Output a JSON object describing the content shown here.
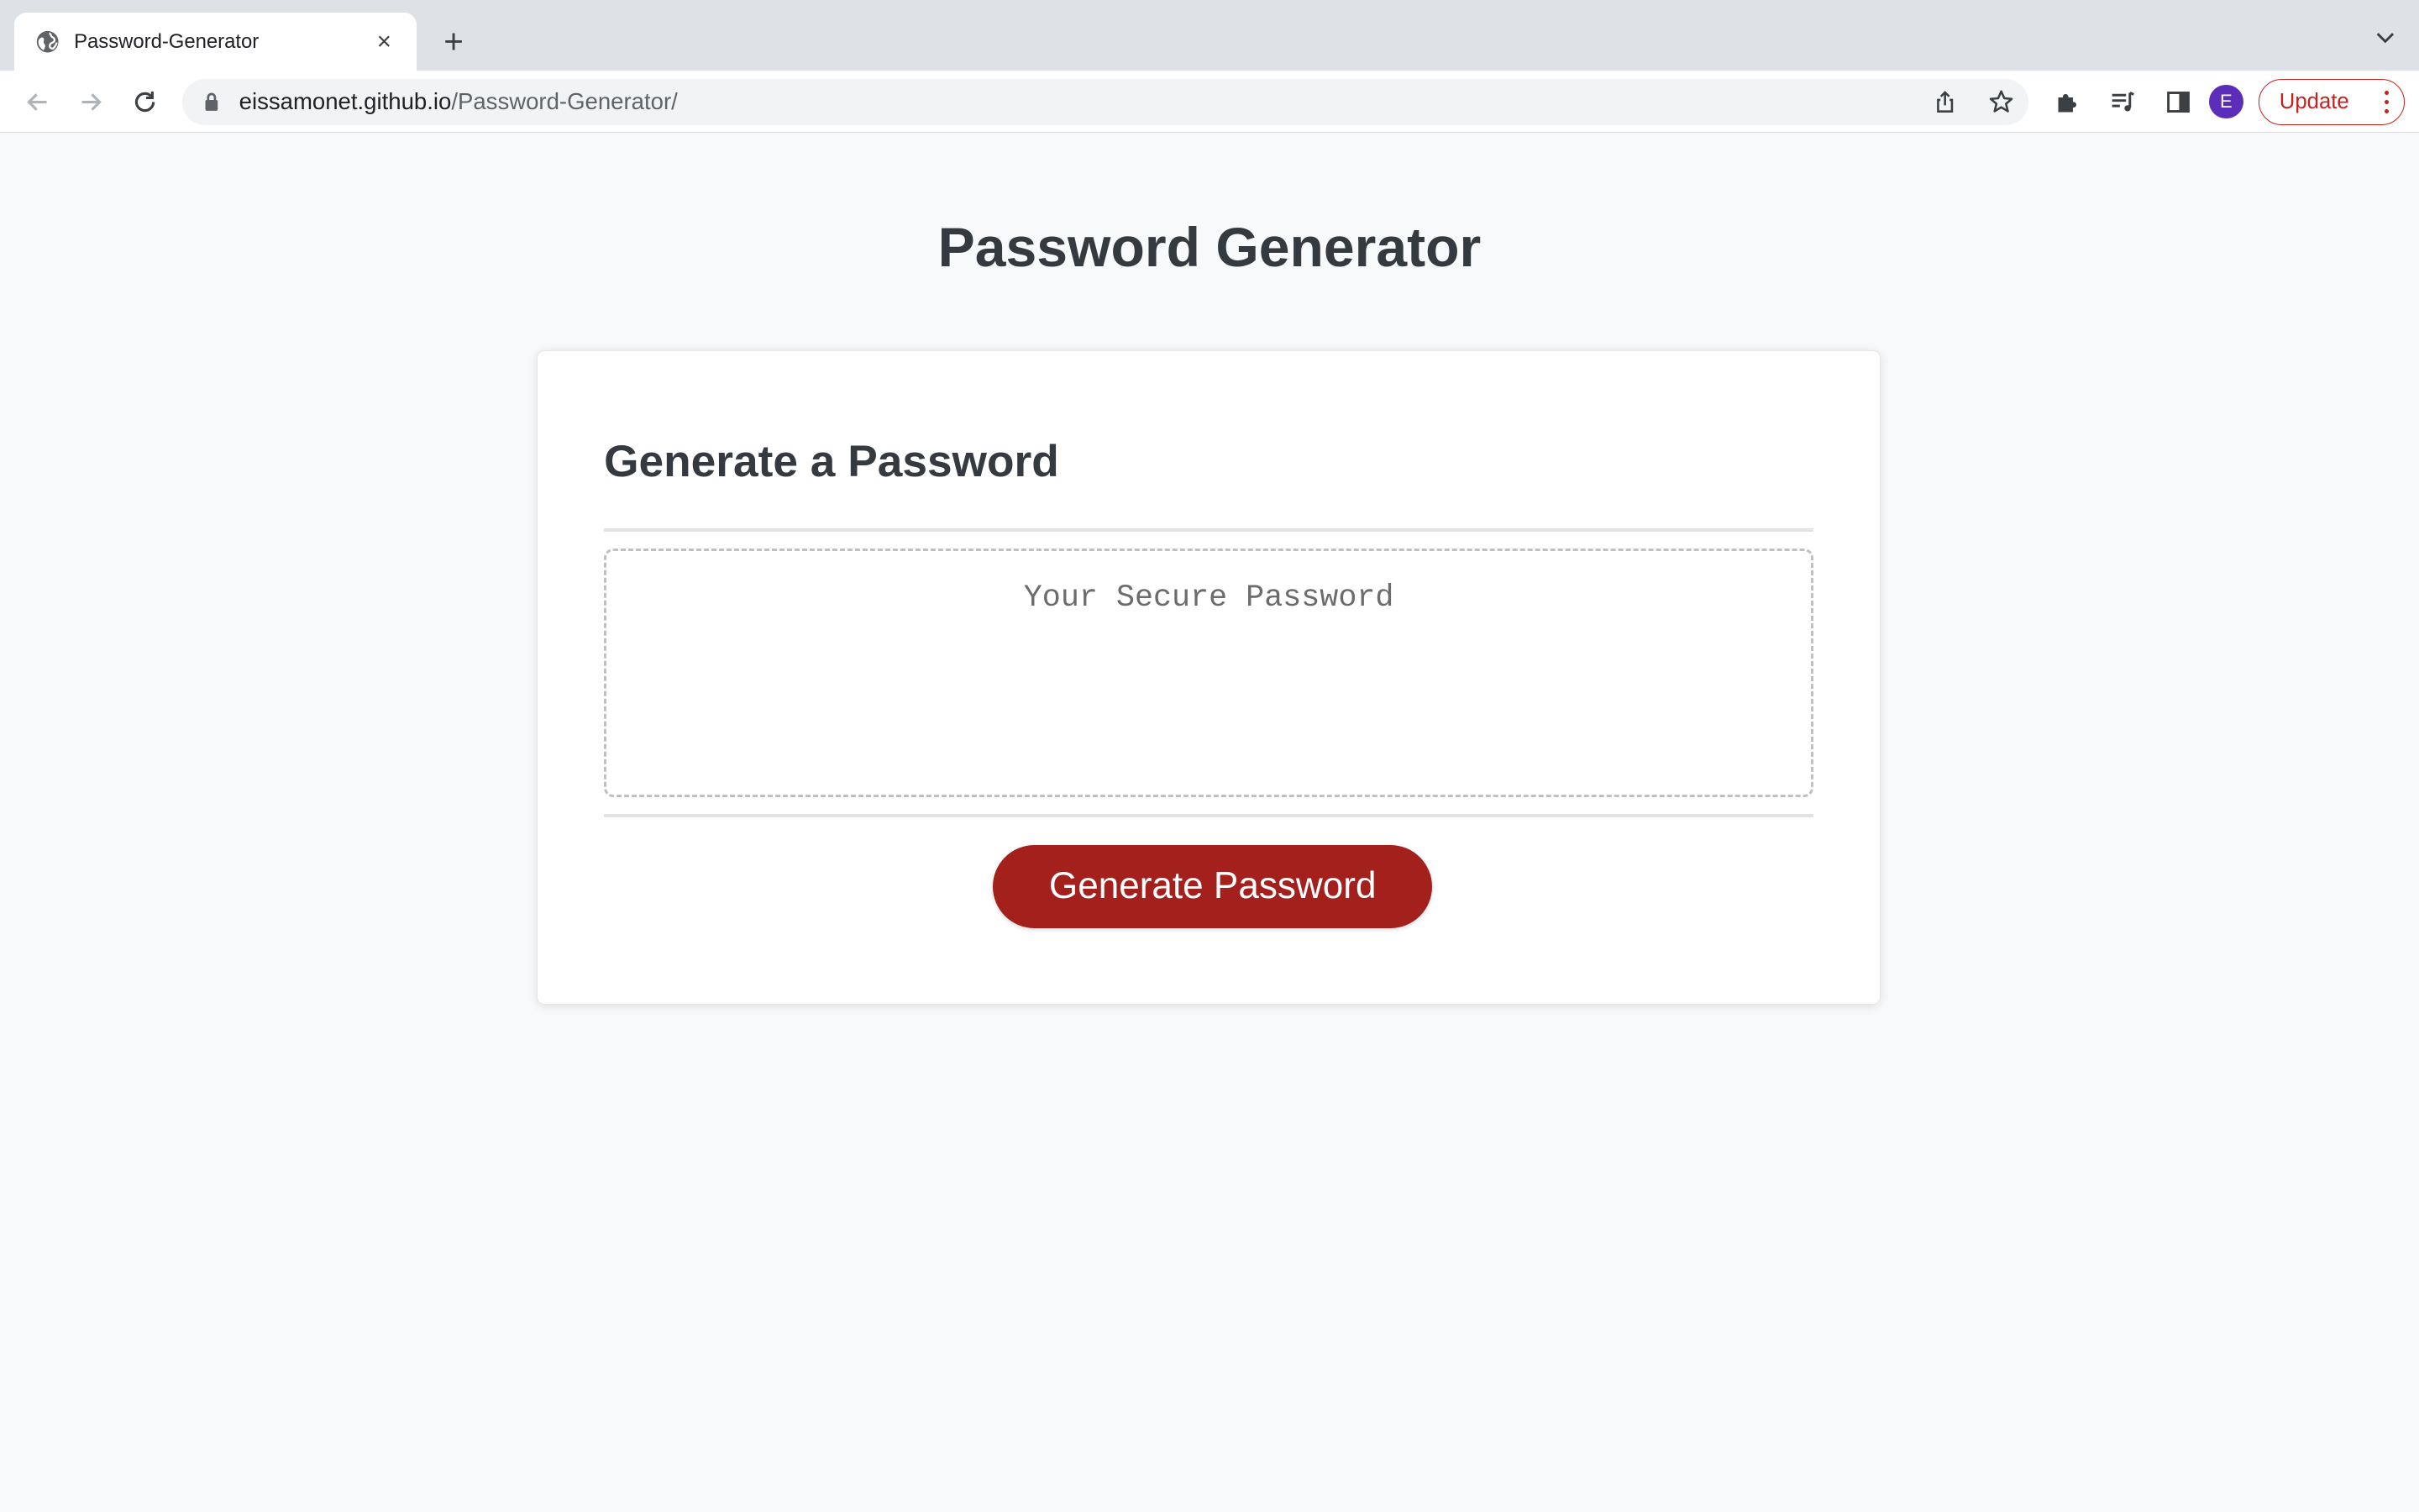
{
  "browser": {
    "tab": {
      "title": "Password-Generator",
      "close_glyph": "×",
      "favicon": "globe-icon"
    },
    "new_tab_glyph": "+",
    "address": {
      "host": "eissamonet.github.io",
      "path": "/Password-Generator/"
    },
    "profile_initial": "E",
    "update_label": "Update"
  },
  "page": {
    "title": "Password Generator",
    "card": {
      "header": "Generate a Password",
      "password_placeholder": "Your Secure Password",
      "password_value": "",
      "generate_button": "Generate Password"
    }
  },
  "colors": {
    "button_bg": "#a4201d",
    "heading_text": "#343a40",
    "avatar_bg": "#5b2db8",
    "update_accent": "#c5221f"
  }
}
